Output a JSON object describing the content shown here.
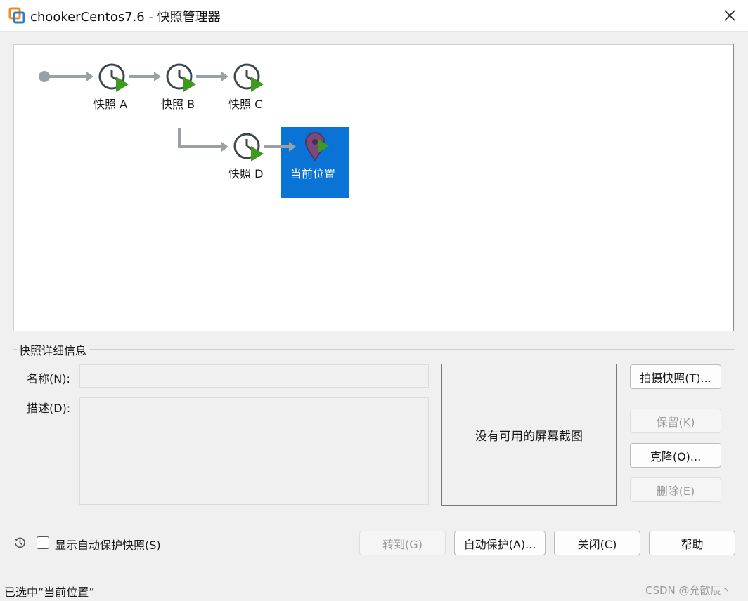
{
  "window": {
    "title": "chookerCentos7.6 - 快照管理器"
  },
  "tree": {
    "snapshots": [
      {
        "label": "快照 A"
      },
      {
        "label": "快照 B"
      },
      {
        "label": "快照 C"
      },
      {
        "label": "快照 D"
      }
    ],
    "current": {
      "label": "当前位置",
      "selected": true
    }
  },
  "details": {
    "group_title": "快照详细信息",
    "name_label": "名称(N):",
    "name_value": "",
    "desc_label": "描述(D):",
    "desc_value": "",
    "preview_text": "没有可用的屏幕截图"
  },
  "side_buttons": {
    "take": {
      "label": "拍摄快照(T)...",
      "enabled": true
    },
    "keep": {
      "label": "保留(K)",
      "enabled": false
    },
    "clone": {
      "label": "克隆(O)...",
      "enabled": true
    },
    "delete": {
      "label": "删除(E)",
      "enabled": false
    }
  },
  "footer": {
    "show_autoprotect_label": "显示自动保护快照(S)",
    "show_autoprotect_checked": false,
    "goto": {
      "label": "转到(G)",
      "enabled": false
    },
    "autoprotect": {
      "label": "自动保护(A)...",
      "enabled": true
    },
    "close": {
      "label": "关闭(C)",
      "enabled": true
    },
    "help": {
      "label": "帮助",
      "enabled": true
    }
  },
  "status": {
    "text": "已选中“当前位置”"
  },
  "watermark": "CSDN @允歆辰丶",
  "colors": {
    "selection": "#0a74d6",
    "play_arrow": "#3f9a1e",
    "connector": "#9aa0a6",
    "clock": "#3b4650",
    "pin": "#7a4a7a"
  }
}
